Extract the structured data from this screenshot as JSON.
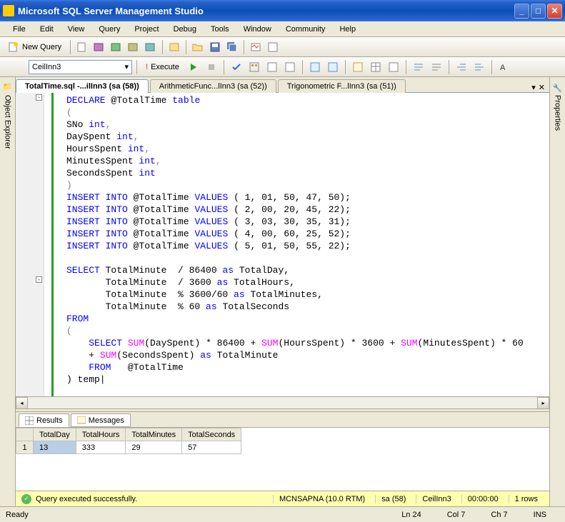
{
  "window": {
    "title": "Microsoft SQL Server Management Studio"
  },
  "menu": {
    "file": "File",
    "edit": "Edit",
    "view": "View",
    "query": "Query",
    "project": "Project",
    "debug": "Debug",
    "tools": "Tools",
    "window": "Window",
    "community": "Community",
    "help": "Help"
  },
  "toolbar": {
    "new_query": "New Query",
    "execute": "Execute",
    "database": "CeilInn3"
  },
  "side": {
    "left": "Object Explorer",
    "right": "Properties"
  },
  "tabs": {
    "t1": "TotalTime.sql -...ilInn3 (sa (58))",
    "t2": "ArithmeticFunc...lInn3 (sa (52))",
    "t3": "Trigonometric F...lInn3 (sa (51))"
  },
  "code": {
    "l1a": "DECLARE",
    "l1b": " @TotalTime ",
    "l1c": "table",
    "l2": "(",
    "l3a": "SNo ",
    "l3b": "int",
    "l3c": ",",
    "l4a": "DaySpent ",
    "l4b": "int",
    "l4c": ",",
    "l5a": "HoursSpent ",
    "l5b": "int",
    "l5c": ",",
    "l6a": "MinutesSpent ",
    "l6b": "int",
    "l6c": ",",
    "l7a": "SecondsSpent ",
    "l7b": "int",
    "l8": ")",
    "ins": "INSERT",
    "into": "INTO",
    "vals": "VALUES",
    "tgt": " @TotalTime ",
    "v1": " ( 1, 01, 50, 47, 50);",
    "v2": " ( 2, 00, 20, 45, 22);",
    "v3": " ( 3, 03, 30, 35, 31);",
    "v4": " ( 4, 00, 60, 25, 52);",
    "v5": " ( 5, 01, 50, 55, 22);",
    "sel": "SELECT",
    "frm": "FROM",
    "sum": "SUM",
    "as": "as",
    "s1": " TotalMinute  / 86400 ",
    "s1b": " TotalDay,",
    "s2": "       TotalMinute  / 3600 ",
    "s2b": " TotalHours,",
    "s3": "       TotalMinute  % 3600/60 ",
    "s3b": " TotalMinutes,",
    "s4": "       TotalMinute  % 60 ",
    "s4b": " TotalSeconds",
    "sub1": "(DaySpent) * 86400 + ",
    "sub2": "(HoursSpent) * 3600 + ",
    "sub3": "(MinutesSpent) * 60",
    "sub4": "    + ",
    "sub5": "(SecondsSpent) ",
    "sub6": " TotalMinute",
    "sub7": "   @TotalTime",
    "temp": ") temp|",
    "lp": "(",
    "indent4": "    ",
    "space": " "
  },
  "results": {
    "tab_results": "Results",
    "tab_messages": "Messages",
    "headers": [
      "",
      "TotalDay",
      "TotalHours",
      "TotalMinutes",
      "TotalSeconds"
    ],
    "row1": [
      "1",
      "13",
      "333",
      "29",
      "57"
    ]
  },
  "status_yellow": {
    "msg": "Query executed successfully.",
    "server": "MCNSAPNA (10.0 RTM)",
    "user": "sa (58)",
    "db": "CeilInn3",
    "time": "00:00:00",
    "rows": "1 rows"
  },
  "statusbar": {
    "ready": "Ready",
    "ln": "Ln 24",
    "col": "Col 7",
    "ch": "Ch 7",
    "ins": "INS"
  }
}
